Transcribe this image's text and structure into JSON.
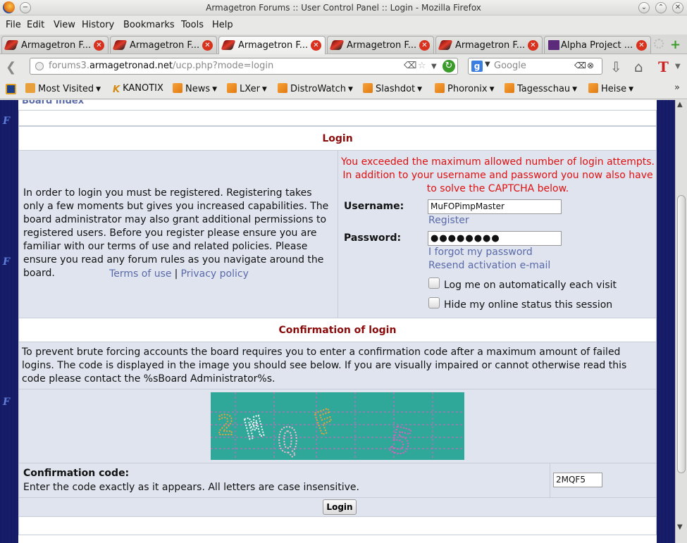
{
  "window": {
    "title": "Armagetron Forums :: User Control Panel :: Login - Mozilla Firefox"
  },
  "menu": [
    "File",
    "Edit",
    "View",
    "History",
    "Bookmarks",
    "Tools",
    "Help"
  ],
  "tabs": [
    {
      "label": "Armagetron F...",
      "active": false
    },
    {
      "label": "Armagetron F...",
      "active": false
    },
    {
      "label": "Armagetron F...",
      "active": true
    },
    {
      "label": "Armagetron F...",
      "active": false
    },
    {
      "label": "Armagetron F...",
      "active": false
    },
    {
      "label": "Alpha Project ...",
      "active": false
    }
  ],
  "nav": {
    "url_prefix": "forums3.",
    "url_domain": "armagetronad.net",
    "url_path": "/ucp.php?mode=login",
    "search_placeholder": "Google"
  },
  "bookmarks": [
    {
      "label": "Most Visited",
      "icon": "folder-icon",
      "dropdown": true
    },
    {
      "label": "KANOTIX",
      "icon": "kanotix-icon",
      "dropdown": false
    },
    {
      "label": "News",
      "icon": "rss-icon",
      "dropdown": true
    },
    {
      "label": "LXer",
      "icon": "rss-icon",
      "dropdown": true
    },
    {
      "label": "DistroWatch",
      "icon": "rss-icon",
      "dropdown": true
    },
    {
      "label": "Slashdot",
      "icon": "rss-icon",
      "dropdown": true
    },
    {
      "label": "Phoronix",
      "icon": "rss-icon",
      "dropdown": true
    },
    {
      "label": "Tagesschau",
      "icon": "rss-icon",
      "dropdown": true
    },
    {
      "label": "Heise",
      "icon": "rss-icon",
      "dropdown": true
    }
  ],
  "page": {
    "board_index": "Board index",
    "login_header": "Login",
    "intro_text": "In order to login you must be registered. Registering takes only a few moments but gives you increased capabilities. The board administrator may also grant additional permissions to registered users. Before you register please ensure you are familiar with our terms of use and related policies. Please ensure you read any forum rules as you navigate around the board.",
    "terms_link": "Terms of use",
    "separator": "|",
    "privacy_link": "Privacy policy",
    "error_text": "You exceeded the maximum allowed number of login attempts. In addition to your username and password you now also have to solve the CAPTCHA below.",
    "username_label": "Username:",
    "username_value": "MuFOPimpMaster",
    "register_link": "Register",
    "password_label": "Password:",
    "password_mask": "●●●●●●●●",
    "forgot_link": "I forgot my password",
    "resend_link": "Resend activation e-mail",
    "autologin_label": "Log me on automatically each visit",
    "hide_status_label": "Hide my online status this session",
    "confirm_header": "Confirmation of login",
    "confirm_text": "To prevent brute forcing accounts the board requires you to enter a confirmation code after a maximum amount of failed logins. The code is displayed in the image you should see below. If you are visually impaired or cannot otherwise read this code please contact the %sBoard Administrator%s.",
    "captcha_text": "2MQF5",
    "code_label": "Confirmation code:",
    "code_hint": "Enter the code exactly as it appears. All letters are case insensitive.",
    "code_value": "2MQF5",
    "login_button": "Login"
  },
  "colors": {
    "header_text": "#8b0a0a",
    "error_text": "#e01010",
    "link": "#5a6aa9",
    "row_bg": "#dfe4ee",
    "captcha_bg": "#2fa89a"
  }
}
